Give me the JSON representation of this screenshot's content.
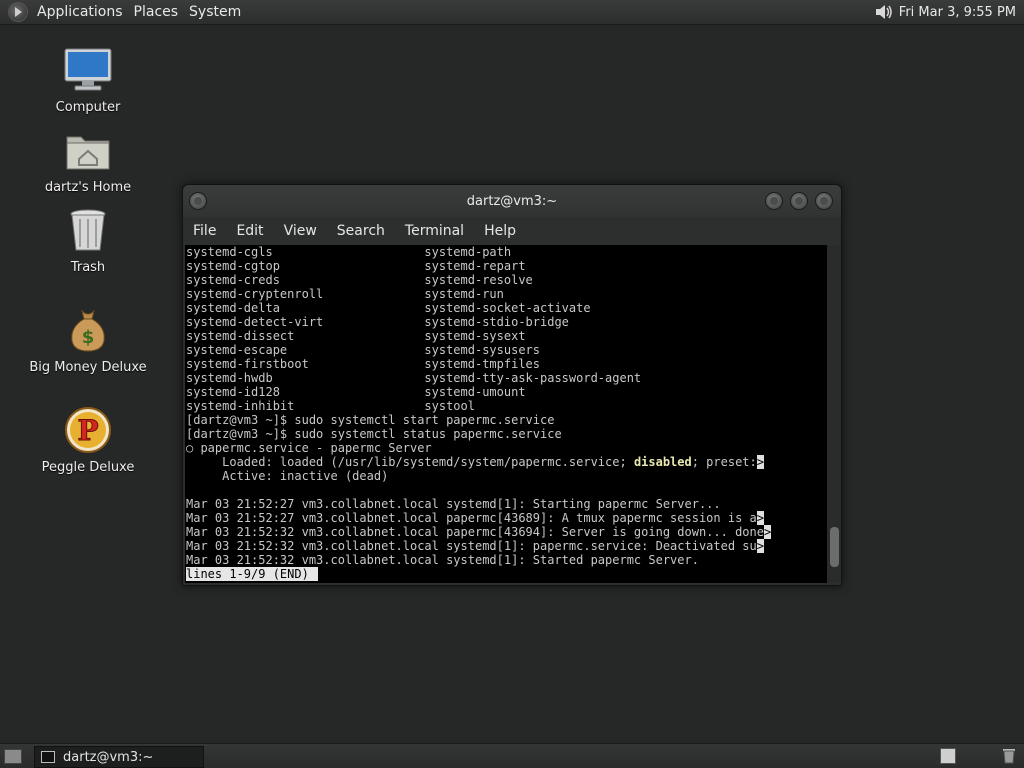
{
  "top_panel": {
    "menus": [
      "Applications",
      "Places",
      "System"
    ],
    "clock": "Fri Mar  3,  9:55 PM"
  },
  "desktop": {
    "icons": [
      {
        "label": "Computer",
        "icon": "computer-icon"
      },
      {
        "label": "dartz's Home",
        "icon": "home-folder-icon"
      },
      {
        "label": "Trash",
        "icon": "trash-icon"
      },
      {
        "label": "Big Money Deluxe",
        "icon": "money-bag-icon"
      },
      {
        "label": "Peggle Deluxe",
        "icon": "peggle-icon"
      }
    ]
  },
  "window": {
    "title": "dartz@vm3:~",
    "menus": [
      "File",
      "Edit",
      "View",
      "Search",
      "Terminal",
      "Help"
    ]
  },
  "terminal": {
    "lines": [
      "systemd-cgls                     systemd-path",
      "systemd-cgtop                    systemd-repart",
      "systemd-creds                    systemd-resolve",
      "systemd-cryptenroll              systemd-run",
      "systemd-delta                    systemd-socket-activate",
      "systemd-detect-virt              systemd-stdio-bridge",
      "systemd-dissect                  systemd-sysext",
      "systemd-escape                   systemd-sysusers",
      "systemd-firstboot                systemd-tmpfiles",
      "systemd-hwdb                     systemd-tty-ask-password-agent",
      "systemd-id128                    systemd-umount",
      "systemd-inhibit                  systool",
      "[dartz@vm3 ~]$ sudo systemctl start papermc.service",
      "[dartz@vm3 ~]$ sudo systemctl status papermc.service",
      "○ papermc.service - papermc Server"
    ],
    "loaded_prefix": "     Loaded: loaded (/usr/lib/systemd/system/papermc.service; ",
    "loaded_bold": "disabled",
    "loaded_suffix": "; preset:",
    "active_line": "     Active: inactive (dead)",
    "blank": "",
    "log_lines": [
      {
        "text": "Mar 03 21:52:27 vm3.collabnet.local systemd[1]: Starting papermc Server...",
        "trunc": false
      },
      {
        "text": "Mar 03 21:52:27 vm3.collabnet.local papermc[43689]: A tmux papermc session is a",
        "trunc": true
      },
      {
        "text": "Mar 03 21:52:32 vm3.collabnet.local papermc[43694]: Server is going down... done",
        "trunc": true
      },
      {
        "text": "Mar 03 21:52:32 vm3.collabnet.local systemd[1]: papermc.service: Deactivated su",
        "trunc": true
      },
      {
        "text": "Mar 03 21:52:32 vm3.collabnet.local systemd[1]: Started papermc Server.",
        "trunc": false
      }
    ],
    "trunc_marker": ">",
    "pager_status": "lines 1-9/9 (END)"
  },
  "bottom_panel": {
    "task_label": "dartz@vm3:~"
  }
}
